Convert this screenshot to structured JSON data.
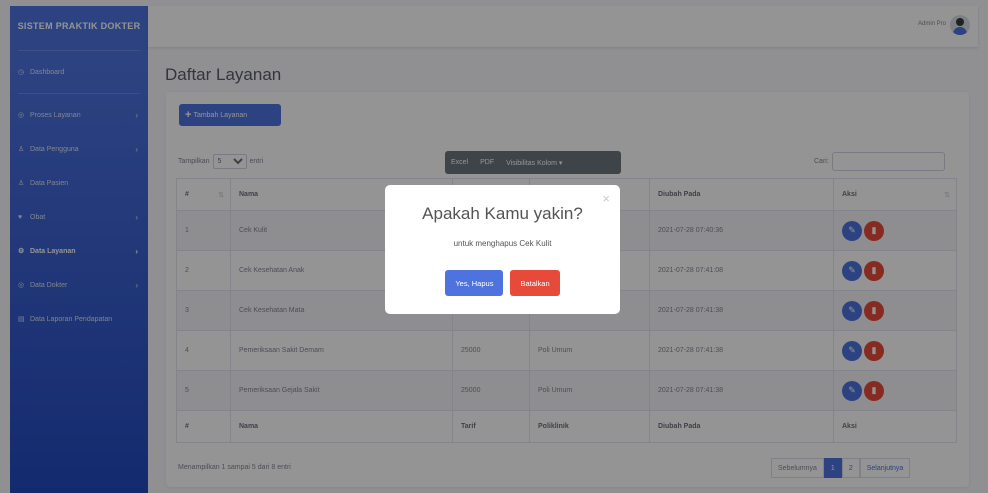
{
  "sidebar": {
    "brand": "SISTEM PRAKTIK DOKTER",
    "items": [
      {
        "label": "Dashboard",
        "icon": "dashboard-icon",
        "chevron": false
      },
      {
        "label": "Proses Layanan",
        "icon": "process-icon",
        "chevron": true
      },
      {
        "label": "Data Pengguna",
        "icon": "users-icon",
        "chevron": true
      },
      {
        "label": "Data Pasien",
        "icon": "patient-icon",
        "chevron": false
      },
      {
        "label": "Obat",
        "icon": "pill-icon",
        "chevron": true
      },
      {
        "label": "Data Layanan",
        "icon": "gear-icon",
        "chevron": true,
        "active": true
      },
      {
        "label": "Data Dokter",
        "icon": "doctor-icon",
        "chevron": true
      },
      {
        "label": "Data Laporan Pendapatan",
        "icon": "report-icon",
        "chevron": false
      }
    ]
  },
  "topbar": {
    "user_name": "Admin Pro"
  },
  "page": {
    "title": "Daftar Layanan"
  },
  "toolbar": {
    "add_label": "Tambah Layanan",
    "show_prefix": "Tampilkan",
    "show_value": "5",
    "show_suffix": "entri",
    "excel": "Excel",
    "pdf": "PDF",
    "col_vis": "Visibilitas Kolom",
    "search_label": "Cari:"
  },
  "table": {
    "headers": [
      "#",
      "Nama",
      "Tarif",
      "Poliklinik",
      "Diubah Pada",
      "Aksi"
    ],
    "rows": [
      {
        "no": "1",
        "nama": "Cek Kulit",
        "tarif": "",
        "poli": "",
        "diubah": "2021-07-28 07:40:36"
      },
      {
        "no": "2",
        "nama": "Cek Kesehatan Anak",
        "tarif": "",
        "poli": "",
        "diubah": "2021-07-28 07:41:08"
      },
      {
        "no": "3",
        "nama": "Cek Kesehatan Mata",
        "tarif": "",
        "poli": "",
        "diubah": "2021-07-28 07:41:38"
      },
      {
        "no": "4",
        "nama": "Pemeriksaan Sakit Demam",
        "tarif": "25000",
        "poli": "Poli Umum",
        "diubah": "2021-07-28 07:41:38"
      },
      {
        "no": "5",
        "nama": "Pemeriksaan Gejala Sakit",
        "tarif": "25000",
        "poli": "Poli Umum",
        "diubah": "2021-07-28 07:41:38"
      }
    ]
  },
  "footer": {
    "info": "Menampilkan 1 sampai 5 dari 8 entri",
    "prev": "Sebelumnya",
    "page1": "1",
    "page2": "2",
    "next": "Selanjutnya"
  },
  "modal": {
    "title": "Apakah Kamu yakin?",
    "text": "untuk menghapus Cek Kulit",
    "confirm": "Yes, Hapus",
    "cancel": "Batalkan",
    "close": "×"
  },
  "colors": {
    "primary": "#4e73df",
    "danger": "#e74a3b",
    "secondary": "#6c757d"
  }
}
